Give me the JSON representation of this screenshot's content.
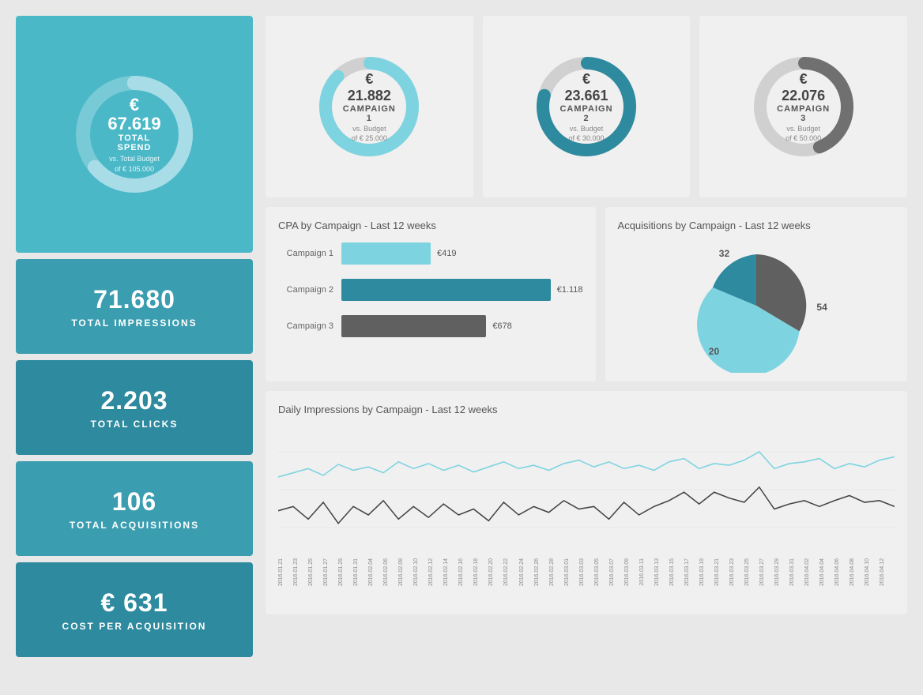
{
  "sidebar": {
    "total_spend": {
      "value": "€ 67.619",
      "label": "TOTAL SPEND",
      "sub1": "vs. Total Budget",
      "sub2": "of € 105.000",
      "donut_percent": 64,
      "color_fg": "#a8dde8",
      "color_bg": "rgba(255,255,255,0.25)"
    },
    "stats": [
      {
        "id": "impressions",
        "value": "71.680",
        "label": "TOTAL IMPRESSIONS"
      },
      {
        "id": "clicks",
        "value": "2.203",
        "label": "TOTAL CLICKS"
      },
      {
        "id": "acquisitions",
        "value": "106",
        "label": "TOTAL ACQUISITIONS"
      },
      {
        "id": "cpa",
        "value": "€ 631",
        "label": "COST PER ACQUISITION"
      }
    ]
  },
  "campaigns": [
    {
      "id": "campaign1",
      "value": "€ 21.882",
      "name": "CAMPAIGN 1",
      "budget_label": "vs. Budget",
      "budget_value": "of € 25.000",
      "percent": 87,
      "color": "#7dd4e0",
      "track_color": "#d0d0d0"
    },
    {
      "id": "campaign2",
      "value": "€ 23.661",
      "name": "CAMPAIGN 2",
      "budget_label": "vs. Budget",
      "budget_value": "of € 30.000",
      "percent": 79,
      "color": "#2e8a9e",
      "track_color": "#d0d0d0"
    },
    {
      "id": "campaign3",
      "value": "€ 22.076",
      "name": "CAMPAIGN 3",
      "budget_label": "vs. Budget",
      "budget_value": "of € 50.000",
      "percent": 44,
      "color": "#707070",
      "track_color": "#d0d0d0"
    }
  ],
  "cpa_chart": {
    "title": "CPA by Campaign - Last 12 weeks",
    "bars": [
      {
        "label": "Campaign 1",
        "value": "€419",
        "width_pct": 37,
        "color": "#7dd4e0"
      },
      {
        "label": "Campaign 2",
        "value": "€1.118",
        "width_pct": 100,
        "color": "#2e8a9e"
      },
      {
        "label": "Campaign 3",
        "value": "€678",
        "width_pct": 60,
        "color": "#606060"
      }
    ]
  },
  "acquisitions_chart": {
    "title": "Acquisitions by Campaign - Last 12 weeks",
    "segments": [
      {
        "label": "32",
        "value": 32,
        "color": "#606060"
      },
      {
        "label": "54",
        "value": 54,
        "color": "#7dd4e0"
      },
      {
        "label": "20",
        "value": 20,
        "color": "#2e8a9e"
      }
    ]
  },
  "line_chart": {
    "title": "Daily Impressions by Campaign - Last 12 weeks",
    "x_labels": [
      "2016.01.21",
      "2016.01.23",
      "2016.01.25",
      "2016.01.27",
      "2016.01.29",
      "2016.01.31",
      "2016.02.04",
      "2016.02.06",
      "2016.02.08",
      "2016.02.10",
      "2016.02.12",
      "2016.02.14",
      "2016.02.16",
      "2016.02.18",
      "2016.02.20",
      "2016.02.22",
      "2016.02.24",
      "2016.02.26",
      "2016.02.28",
      "2016.03.01",
      "2016.03.03",
      "2016.03.05",
      "2016.03.07",
      "2016.03.09",
      "2016.03.11",
      "2016.03.13",
      "2016.03.15",
      "2016.03.17",
      "2016.03.19",
      "2016.03.21",
      "2016.03.23",
      "2016.03.25",
      "2016.03.27",
      "2016.03.29",
      "2016.03.31",
      "2016.04.02",
      "2016.04.04",
      "2016.04.06",
      "2016.04.08",
      "2016.04.10",
      "2016.04.12"
    ]
  }
}
